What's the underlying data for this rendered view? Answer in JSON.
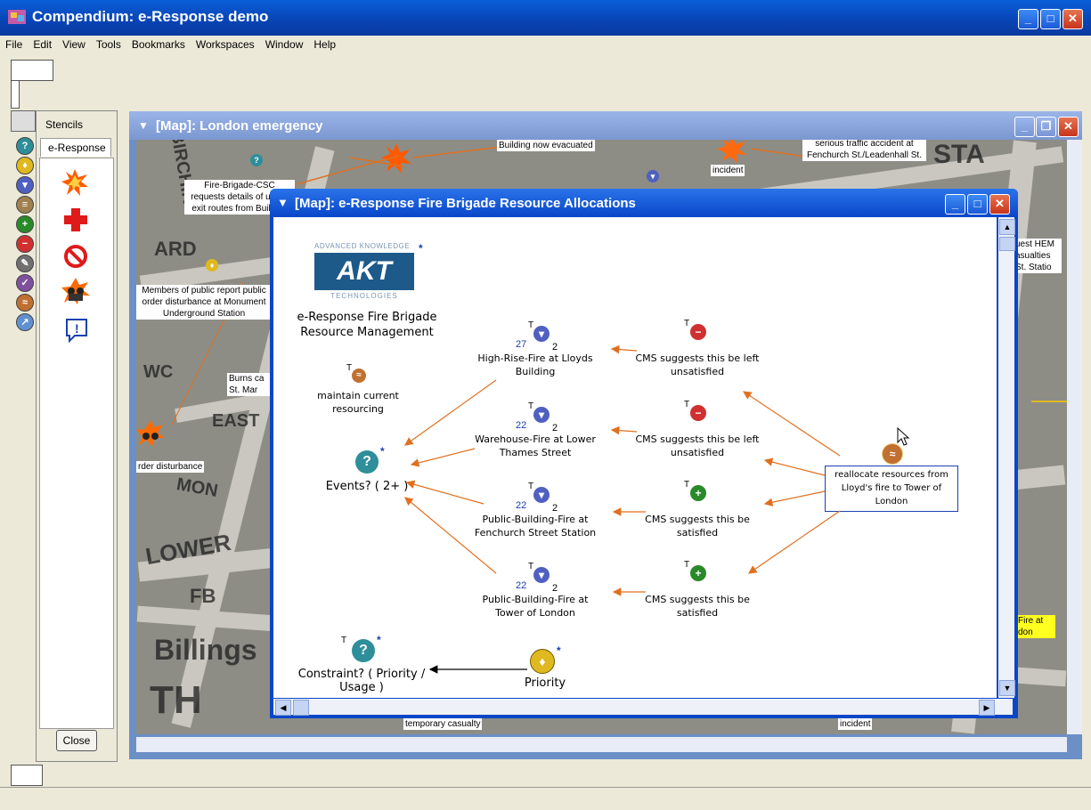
{
  "app": {
    "title": "Compendium: e-Response demo"
  },
  "menu": [
    "File",
    "Edit",
    "View",
    "Tools",
    "Bookmarks",
    "Workspaces",
    "Window",
    "Help"
  ],
  "stencils": {
    "panel_label": "Stencils",
    "tab_label": "e-Response",
    "close_label": "Close"
  },
  "map_window": {
    "title": "[Map]: London emergency"
  },
  "map_labels": [
    "Building now evacuated",
    "incident",
    "serious traffic accident at Fenchurch St./Leadenhall St.",
    "Fire-Brigade-CSC requests details of upper exit routes from Building",
    "Members of public report public order disturbance at Monument Underground Station",
    "Burns ca St. Mar",
    "rder disturbance",
    "uest HEM asualties St. Statio",
    "Fire at don",
    "temporary casualty",
    "incident"
  ],
  "streets": [
    "BIRCHIN",
    "ARD",
    "WC",
    "LOWER",
    "FB",
    "Billings",
    "TH",
    "MON",
    "EAST",
    "STA"
  ],
  "inner_window": {
    "title": "[Map]: e-Response Fire Brigade Resource Allocations"
  },
  "akt_logo": {
    "top": "ADVANCED KNOWLEDGE",
    "mark": "AKT",
    "bottom": "TECHNOLOGIES"
  },
  "nodes": {
    "heading": "e-Response Fire Brigade Resource Management",
    "maintain": "maintain current resourcing",
    "events": "Events? ( 2+ )",
    "constraint": "Constraint? ( Priority / Usage )",
    "priority": "Priority",
    "reallocate": "reallocate resources from Lloyd's fire to Tower of London",
    "fires": [
      {
        "label": "High-Rise-Fire at Lloyds Building",
        "count": "27",
        "sub": "2"
      },
      {
        "label": "Warehouse-Fire at Lower Thames Street",
        "count": "22",
        "sub": "2"
      },
      {
        "label": "Public-Building-Fire at Fenchurch Street Station",
        "count": "22",
        "sub": "2"
      },
      {
        "label": "Public-Building-Fire at Tower of London",
        "count": "22",
        "sub": "2"
      }
    ],
    "cms": [
      {
        "label": "CMS suggests this be left unsatisfied",
        "kind": "con"
      },
      {
        "label": "CMS suggests this be left unsatisfied",
        "kind": "con"
      },
      {
        "label": "CMS suggests this be satisfied",
        "kind": "pro"
      },
      {
        "label": "CMS suggests this be satisfied",
        "kind": "pro"
      }
    ]
  },
  "colors": {
    "arrow": "#e07020",
    "titlebar": "#0a46c8",
    "question": "#2e8e9a",
    "con": "#d03030",
    "pro": "#2a8a2a",
    "idea": "#e0b820"
  }
}
